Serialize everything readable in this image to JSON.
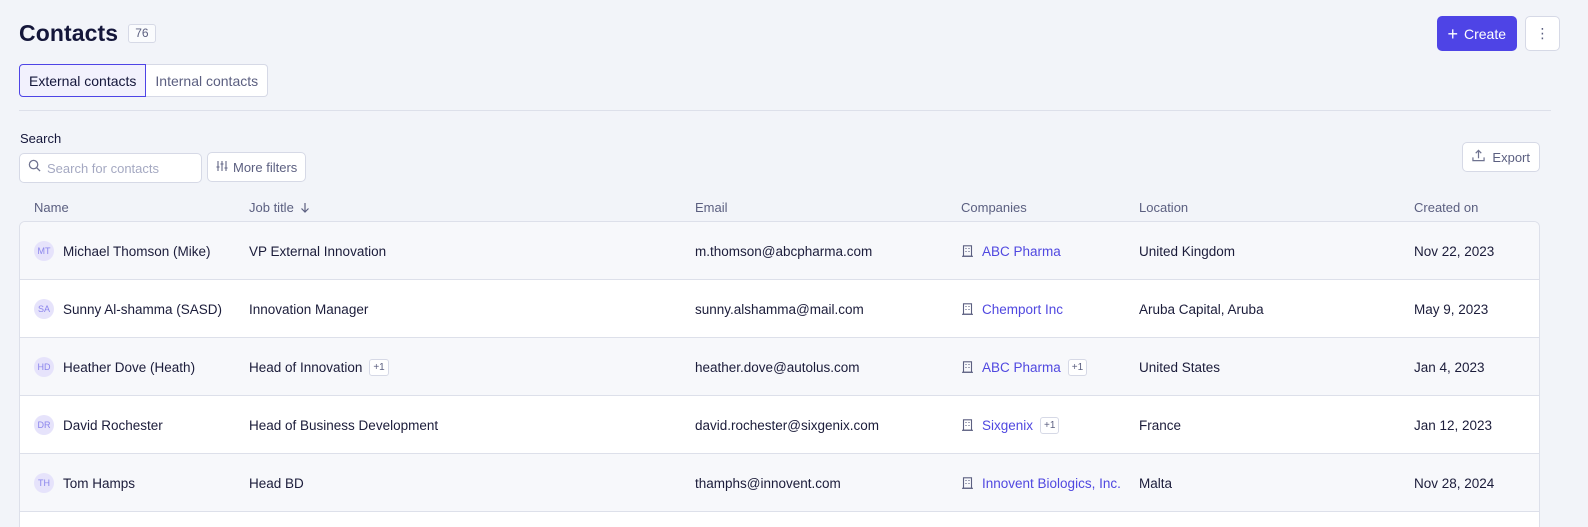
{
  "header": {
    "title": "Contacts",
    "count": "76",
    "create_label": "Create",
    "create_icon": "plus-icon",
    "more_icon": "kebab-icon"
  },
  "tabs": [
    {
      "label": "External contacts",
      "active": true
    },
    {
      "label": "Internal contacts",
      "active": false
    }
  ],
  "search": {
    "label": "Search",
    "placeholder": "Search for contacts",
    "filters_label": "More filters"
  },
  "export_label": "Export",
  "table": {
    "columns": {
      "name": "Name",
      "job": "Job title",
      "email": "Email",
      "companies": "Companies",
      "location": "Location",
      "created": "Created on"
    },
    "sort_column": "job",
    "rows": [
      {
        "initials": "MT",
        "name": "Michael Thomson (Mike)",
        "job": "VP External Innovation",
        "job_extra": "",
        "email": "m.thomson@abcpharma.com",
        "company": "ABC Pharma",
        "company_extra": "",
        "location": "United Kingdom",
        "created": "Nov 22, 2023"
      },
      {
        "initials": "SA",
        "name": "Sunny Al-shamma (SASD)",
        "job": "Innovation Manager",
        "job_extra": "",
        "email": "sunny.alshamma@mail.com",
        "company": "Chemport Inc",
        "company_extra": "",
        "location": "Aruba Capital, Aruba",
        "created": "May 9, 2023"
      },
      {
        "initials": "HD",
        "name": "Heather Dove (Heath)",
        "job": "Head of Innovation",
        "job_extra": "+1",
        "email": "heather.dove@autolus.com",
        "company": "ABC Pharma",
        "company_extra": "+1",
        "location": "United States",
        "created": "Jan 4, 2023"
      },
      {
        "initials": "DR",
        "name": "David Rochester",
        "job": "Head of Business Development",
        "job_extra": "",
        "email": "david.rochester@sixgenix.com",
        "company": "Sixgenix",
        "company_extra": "+1",
        "location": "France",
        "created": "Jan 12, 2023"
      },
      {
        "initials": "TH",
        "name": "Tom Hamps",
        "job": "Head BD",
        "job_extra": "",
        "email": "thamphs@innovent.com",
        "company": "Innovent Biologics, Inc.",
        "company_extra": "",
        "location": "Malta",
        "created": "Nov 28, 2024"
      }
    ]
  },
  "colors": {
    "accent": "#4e44e6",
    "link": "#5048e0",
    "background": "#f2f4f9"
  }
}
